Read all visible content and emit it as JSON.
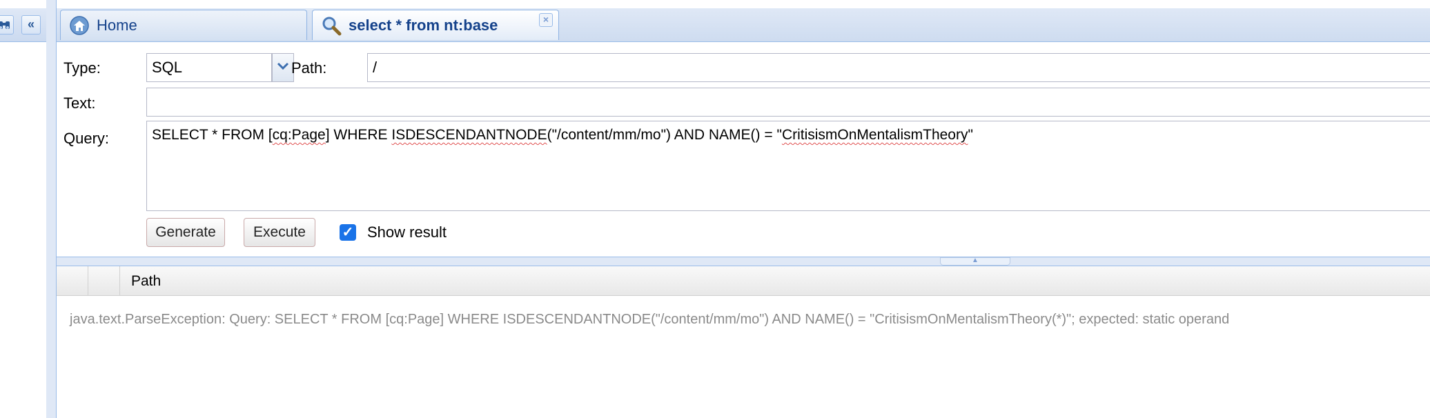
{
  "left_panel": {
    "buttons": [
      {
        "icon": "binoculars-icon"
      },
      {
        "icon": "double-chevron-left-icon",
        "glyph": "«"
      }
    ]
  },
  "tabs": [
    {
      "label": "Home",
      "icon": "home-icon",
      "active": false
    },
    {
      "label": "select * from nt:base",
      "icon": "magnifier-icon",
      "active": true,
      "closable": true,
      "close_glyph": "×"
    }
  ],
  "form": {
    "type_label": "Type:",
    "type_value": "SQL",
    "path_label": "Path:",
    "path_value": "/",
    "text_label": "Text:",
    "text_value": "",
    "query_label": "Query:",
    "query_parts": {
      "p1": "SELECT * FROM [",
      "p2": "cq:Page",
      "p3": "] WHERE ",
      "p4": "ISDESCENDANTNODE",
      "p5": "(\"/content/mm/mo\") AND NAME() = \"",
      "p6": "CritisismOnMentalismTheory",
      "p7": "\""
    },
    "generate_label": "Generate",
    "execute_label": "Execute",
    "show_result_label": "Show result",
    "show_result_checked": true,
    "check_glyph": "✓"
  },
  "results": {
    "columns": [
      "",
      "",
      "Path"
    ],
    "message": "java.text.ParseException: Query: SELECT * FROM [cq:Page] WHERE ISDESCENDANTNODE(\"/content/mm/mo\") AND NAME() = \"CritisismOnMentalismTheory(*)\"; expected: static operand"
  },
  "colors": {
    "accent": "#15428b",
    "header_bg": "#dfe8f6",
    "border": "#99bbe8",
    "checkbox": "#1a73e8",
    "error_text": "#8a8a8a"
  }
}
